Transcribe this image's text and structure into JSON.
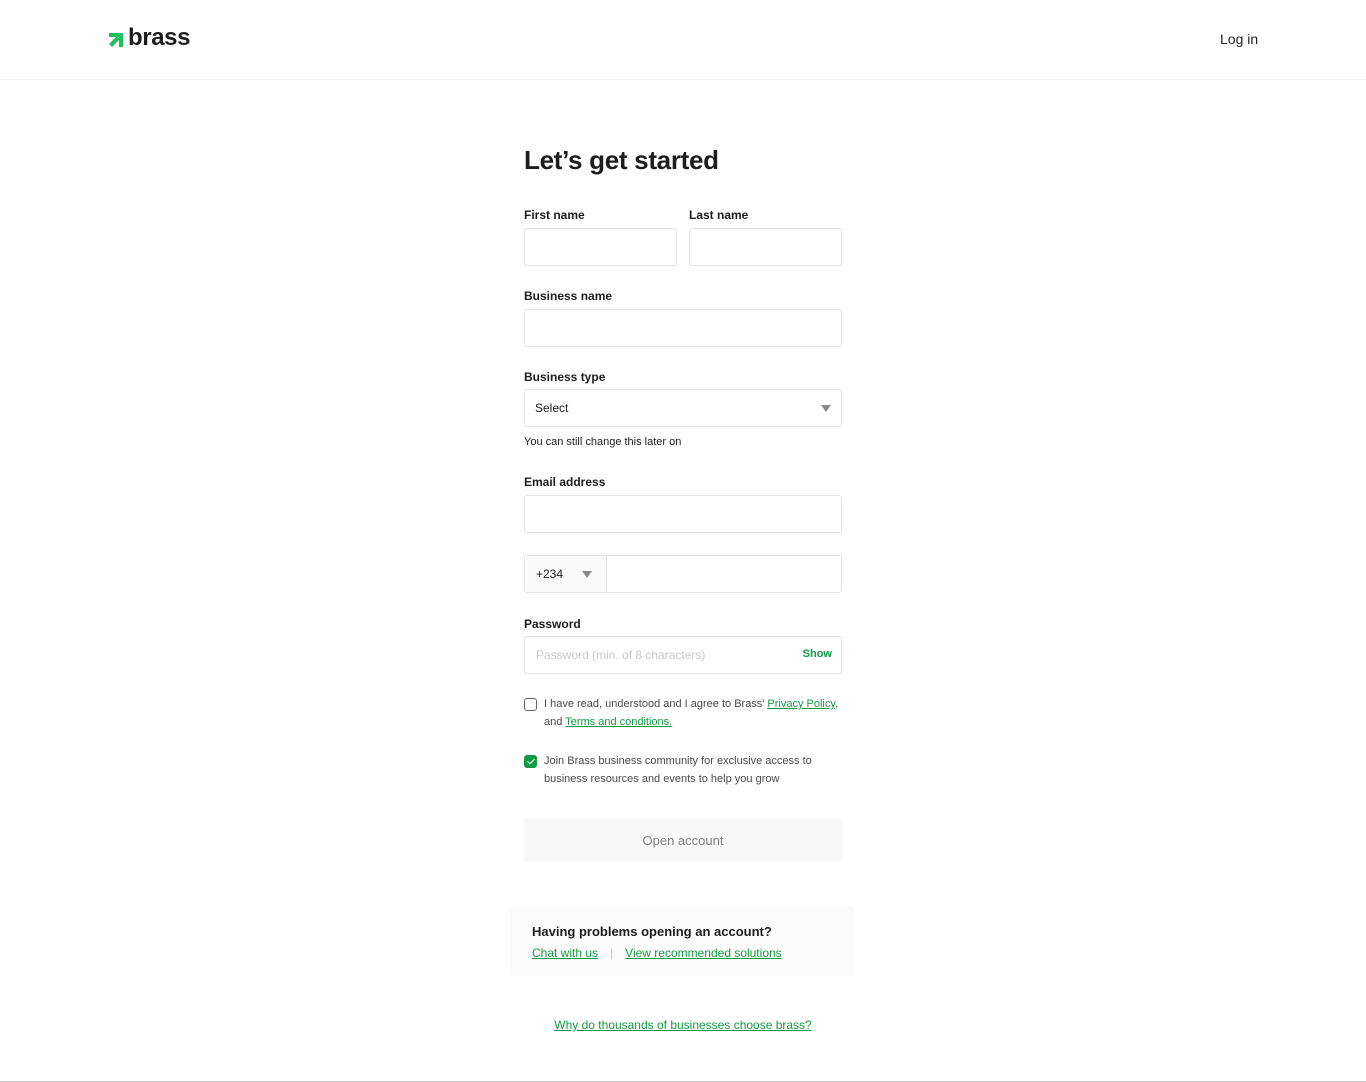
{
  "brand": {
    "name": "brass",
    "color": "#139a47"
  },
  "header": {
    "login_label": "Log in"
  },
  "form": {
    "title": "Let’s get started",
    "first_name": {
      "label": "First name",
      "value": ""
    },
    "last_name": {
      "label": "Last name",
      "value": ""
    },
    "business_name": {
      "label": "Business name",
      "value": ""
    },
    "business_type": {
      "label": "Business type",
      "selected": "Select",
      "hint": "You can still change this later on"
    },
    "email": {
      "label": "Email address",
      "value": ""
    },
    "phone": {
      "country_code": "+234",
      "value": ""
    },
    "password": {
      "label": "Password",
      "placeholder": "Password (min. of 8 characters)",
      "toggle_label": "Show"
    },
    "terms": {
      "checked": false,
      "text_before": "I have read, understood and I agree to Brass’ ",
      "privacy_link": "Privacy Policy",
      "text_middle": ", and ",
      "terms_link": "Terms and conditions."
    },
    "community": {
      "checked": true,
      "text": "Join Brass business community for exclusive access to business resources and events to help you grow"
    },
    "submit_label": "Open account"
  },
  "help": {
    "title": "Having problems opening an account?",
    "chat_link": "Chat with us",
    "separator": "|",
    "solutions_link": "View recommended solutions"
  },
  "footer": {
    "why_link": "Why do thousands of businesses choose brass?"
  }
}
